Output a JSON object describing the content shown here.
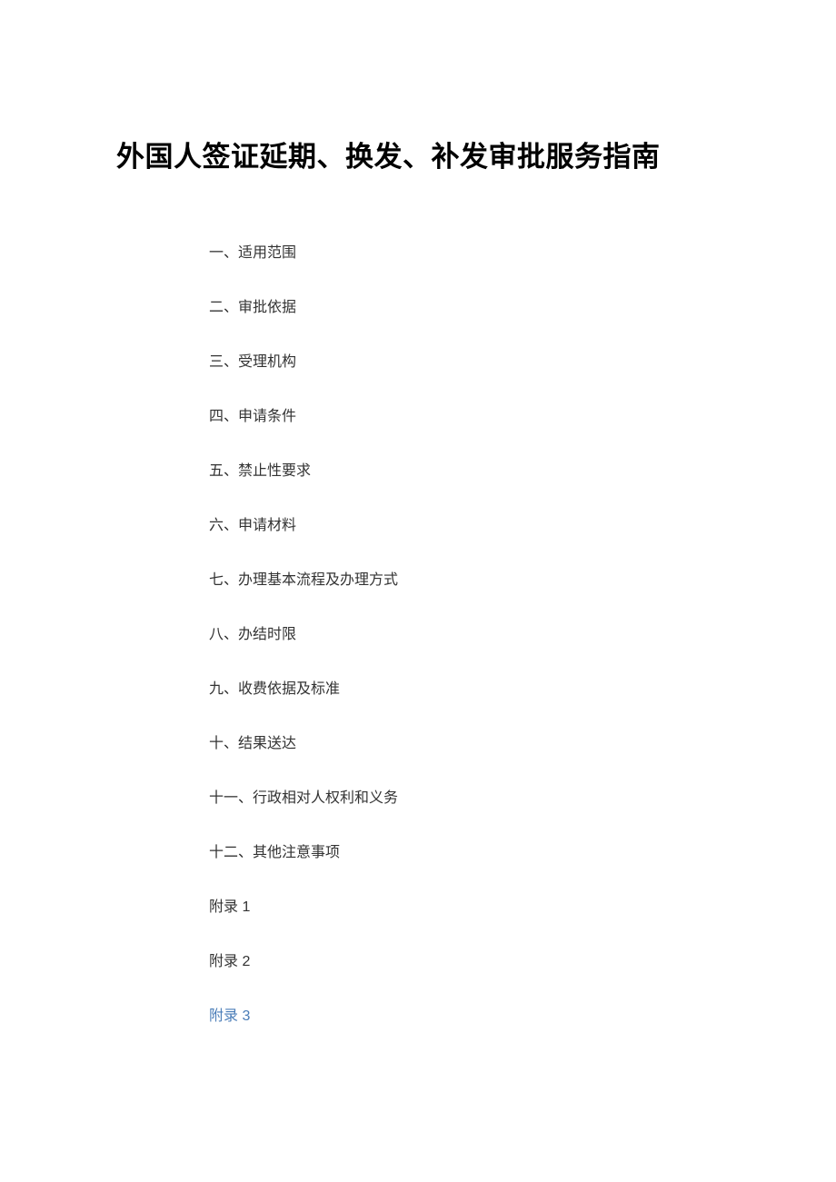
{
  "title": "外国人签证延期、换发、补发审批服务指南",
  "toc": [
    {
      "label": "一、适用范围",
      "link": false
    },
    {
      "label": "二、审批依据",
      "link": false
    },
    {
      "label": "三、受理机构",
      "link": false
    },
    {
      "label": "四、申请条件",
      "link": false
    },
    {
      "label": "五、禁止性要求",
      "link": false
    },
    {
      "label": "六、申请材料",
      "link": false
    },
    {
      "label": "七、办理基本流程及办理方式",
      "link": false
    },
    {
      "label": "八、办结时限",
      "link": false
    },
    {
      "label": "九、收费依据及标准",
      "link": false
    },
    {
      "label": "十、结果送达",
      "link": false
    },
    {
      "label": "十一、行政相对人权利和义务",
      "link": false
    },
    {
      "label": "十二、其他注意事项",
      "link": false
    },
    {
      "label": "附录 1",
      "link": false
    },
    {
      "label": "附录 2",
      "link": false
    },
    {
      "label": "附录 3",
      "link": true
    }
  ]
}
